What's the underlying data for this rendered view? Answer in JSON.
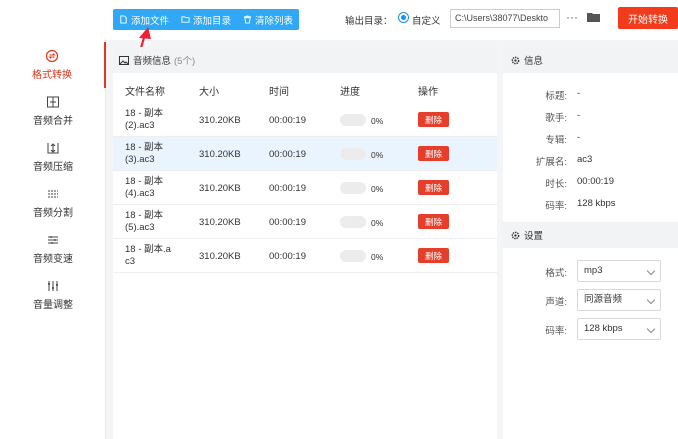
{
  "toolbar": {
    "add_file": "添加文件",
    "add_folder": "添加目录",
    "clear_list": "清除列表",
    "output_label": "输出目录：",
    "custom_label": "自定义",
    "path_value": "C:\\Users\\38077\\Deskto",
    "more": "···",
    "start": "开始转换"
  },
  "sidebar": {
    "items": [
      {
        "label": "格式转换",
        "icon": "format-convert-icon"
      },
      {
        "label": "音频合并",
        "icon": "merge-icon"
      },
      {
        "label": "音频压缩",
        "icon": "compress-icon"
      },
      {
        "label": "音频分割",
        "icon": "split-icon"
      },
      {
        "label": "音频变速",
        "icon": "speed-icon"
      },
      {
        "label": "音量调整",
        "icon": "volume-icon"
      }
    ]
  },
  "files_panel": {
    "title": "音频信息",
    "count": "(5个)",
    "columns": [
      "文件名称",
      "大小",
      "时间",
      "进度",
      "操作"
    ],
    "rows": [
      {
        "name1": "18 - 副本",
        "name2": "(2).ac3",
        "size": "310.20KB",
        "time": "00:00:19",
        "progress": 0,
        "percent": "0%",
        "action": "删除"
      },
      {
        "name1": "18 - 副本",
        "name2": "(3).ac3",
        "size": "310.20KB",
        "time": "00:00:19",
        "progress": 0,
        "percent": "0%",
        "action": "删除"
      },
      {
        "name1": "18 - 副本",
        "name2": "(4).ac3",
        "size": "310.20KB",
        "time": "00:00:19",
        "progress": 0,
        "percent": "0%",
        "action": "删除"
      },
      {
        "name1": "18 - 副本",
        "name2": "(5).ac3",
        "size": "310.20KB",
        "time": "00:00:19",
        "progress": 0,
        "percent": "0%",
        "action": "删除"
      },
      {
        "name1": "18 - 副本.a",
        "name2": "c3",
        "size": "310.20KB",
        "time": "00:00:19",
        "progress": 0,
        "percent": "0%",
        "action": "删除"
      }
    ]
  },
  "info": {
    "title": "信息",
    "fields": [
      {
        "key": "标题:",
        "value": "-"
      },
      {
        "key": "歌手:",
        "value": "-"
      },
      {
        "key": "专辑:",
        "value": "-"
      },
      {
        "key": "扩展名:",
        "value": "ac3"
      },
      {
        "key": "时长:",
        "value": "00:00:19"
      },
      {
        "key": "码率:",
        "value": "128 kbps"
      }
    ]
  },
  "settings": {
    "title": "设置",
    "format_label": "格式:",
    "format_value": "mp3",
    "channel_label": "声道:",
    "channel_value": "同源音频",
    "bitrate_label": "码率:",
    "bitrate_value": "128 kbps"
  },
  "colors": {
    "accent_blue": "#31a8f5",
    "danger_red": "#e53f2b",
    "start_red": "#f23b1b"
  }
}
